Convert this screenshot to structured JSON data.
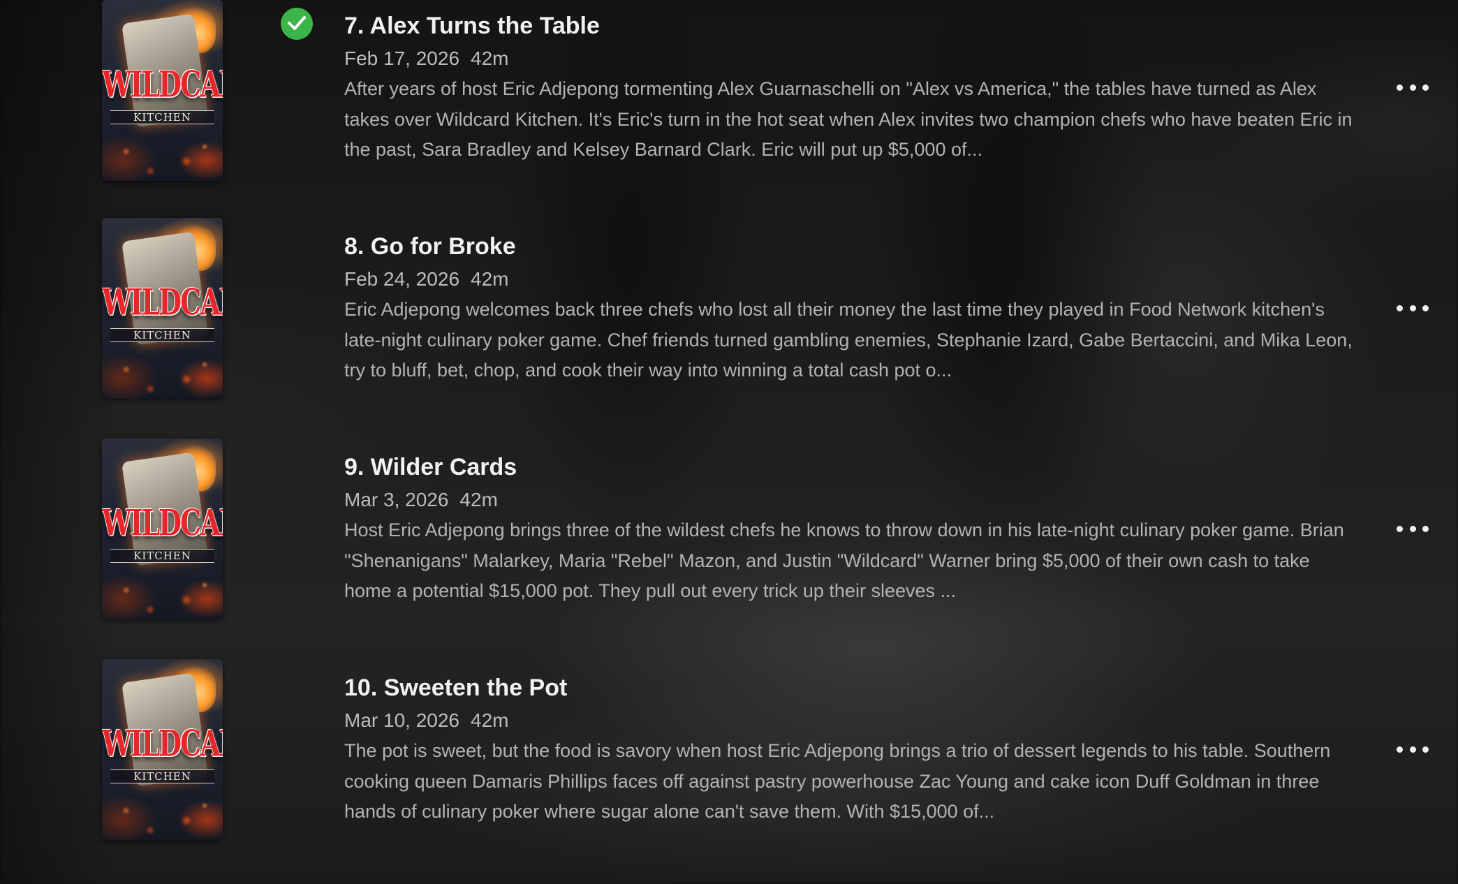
{
  "episodes": [
    {
      "title": "7. Alex Turns the Table",
      "date": "Feb 17, 2026",
      "runtime": "42m",
      "watched": true,
      "description": "After years of host Eric Adjepong tormenting Alex Guarnaschelli on \"Alex vs America,\" the tables have turned as Alex takes over Wildcard Kitchen. It's Eric's turn in the hot seat when Alex invites two champion chefs who have beaten Eric in the past, Sara Bradley and Kelsey Barnard Clark. Eric will put up $5,000 of...",
      "poster": {
        "word": "WILDCARD",
        "sub": "KITCHEN"
      }
    },
    {
      "title": "8. Go for Broke",
      "date": "Feb 24, 2026",
      "runtime": "42m",
      "watched": false,
      "description": "Eric Adjepong welcomes back three chefs who lost all their money the last time they played in Food Network kitchen's late-night culinary poker game. Chef friends turned gambling enemies, Stephanie Izard, Gabe Bertaccini, and Mika Leon, try to bluff, bet, chop, and cook their way into winning a total cash pot o...",
      "poster": {
        "word": "WILDCARD",
        "sub": "KITCHEN"
      }
    },
    {
      "title": "9. Wilder Cards",
      "date": "Mar 3, 2026",
      "runtime": "42m",
      "watched": false,
      "description": "Host Eric Adjepong brings three of the wildest chefs he knows to throw down in his late-night culinary poker game. Brian \"Shenanigans\" Malarkey, Maria \"Rebel\" Mazon, and Justin \"Wildcard\" Warner bring $5,000 of their own cash to take home a potential $15,000 pot. They pull out every trick up their sleeves ...",
      "poster": {
        "word": "WILDCARD",
        "sub": "KITCHEN"
      }
    },
    {
      "title": "10. Sweeten the Pot",
      "date": "Mar 10, 2026",
      "runtime": "42m",
      "watched": false,
      "description": "The pot is sweet, but the food is savory when host Eric Adjepong brings a trio of dessert legends to his table. Southern cooking queen Damaris Phillips faces off against pastry powerhouse Zac Young and cake icon Duff Goldman in three hands of culinary poker where sugar alone can't save them. With $15,000 of...",
      "poster": {
        "word": "WILDCARD",
        "sub": "KITCHEN"
      }
    }
  ],
  "icons": {
    "watched": "check-circle-icon",
    "more": "more-horizontal-icon"
  },
  "colors": {
    "watched_badge": "#3bb54a",
    "title": "#f2f2f2",
    "meta": "#bdbdbd",
    "description": "#b3b3b3"
  }
}
